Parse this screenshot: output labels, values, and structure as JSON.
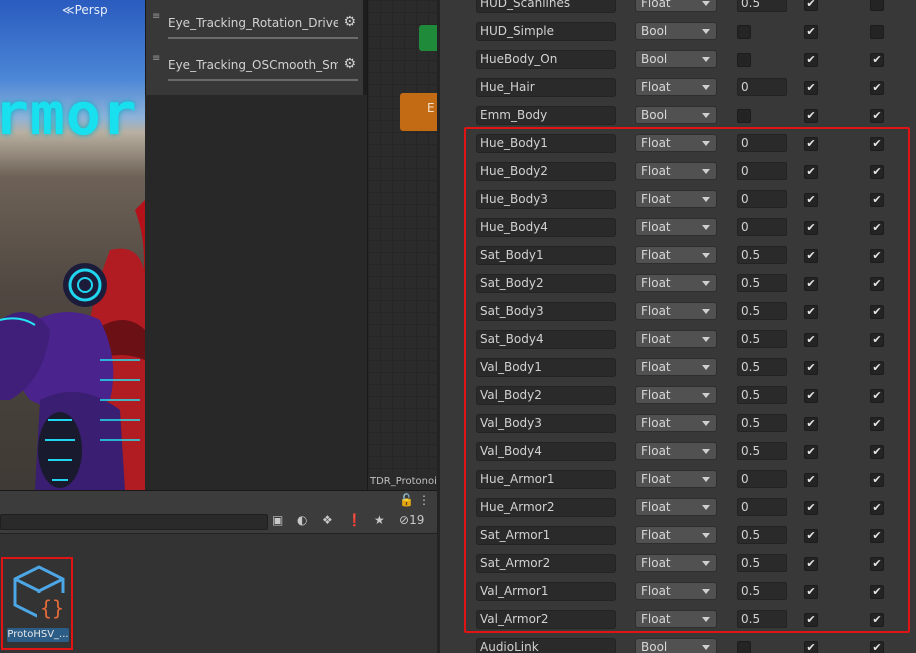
{
  "scene": {
    "view_label": "Persp",
    "neon_text": "rmor"
  },
  "layers": [
    {
      "name": "Eye_Tracking_Rotation_Driver"
    },
    {
      "name": "Eye_Tracking_OSCmooth_Smc"
    }
  ],
  "graph": {
    "footer": "TDR_Protonoid"
  },
  "project": {
    "hidden_count": "19",
    "asset_label": "ProtoHSV_..."
  },
  "params": [
    {
      "name": "HUD_Scanlines",
      "type": "Float",
      "default": "0.5",
      "c1": true,
      "c2": false
    },
    {
      "name": "HUD_Simple",
      "type": "Bool",
      "default": false,
      "c1": true,
      "c2": false
    },
    {
      "name": "HueBody_On",
      "type": "Bool",
      "default": false,
      "c1": true,
      "c2": true
    },
    {
      "name": "Hue_Hair",
      "type": "Float",
      "default": "0",
      "c1": true,
      "c2": true
    },
    {
      "name": "Emm_Body",
      "type": "Bool",
      "default": false,
      "c1": true,
      "c2": true
    },
    {
      "name": "Hue_Body1",
      "type": "Float",
      "default": "0",
      "c1": true,
      "c2": true
    },
    {
      "name": "Hue_Body2",
      "type": "Float",
      "default": "0",
      "c1": true,
      "c2": true
    },
    {
      "name": "Hue_Body3",
      "type": "Float",
      "default": "0",
      "c1": true,
      "c2": true
    },
    {
      "name": "Hue_Body4",
      "type": "Float",
      "default": "0",
      "c1": true,
      "c2": true
    },
    {
      "name": "Sat_Body1",
      "type": "Float",
      "default": "0.5",
      "c1": true,
      "c2": true
    },
    {
      "name": "Sat_Body2",
      "type": "Float",
      "default": "0.5",
      "c1": true,
      "c2": true
    },
    {
      "name": "Sat_Body3",
      "type": "Float",
      "default": "0.5",
      "c1": true,
      "c2": true
    },
    {
      "name": "Sat_Body4",
      "type": "Float",
      "default": "0.5",
      "c1": true,
      "c2": true
    },
    {
      "name": "Val_Body1",
      "type": "Float",
      "default": "0.5",
      "c1": true,
      "c2": true
    },
    {
      "name": "Val_Body2",
      "type": "Float",
      "default": "0.5",
      "c1": true,
      "c2": true
    },
    {
      "name": "Val_Body3",
      "type": "Float",
      "default": "0.5",
      "c1": true,
      "c2": true
    },
    {
      "name": "Val_Body4",
      "type": "Float",
      "default": "0.5",
      "c1": true,
      "c2": true
    },
    {
      "name": "Hue_Armor1",
      "type": "Float",
      "default": "0",
      "c1": true,
      "c2": true
    },
    {
      "name": "Hue_Armor2",
      "type": "Float",
      "default": "0",
      "c1": true,
      "c2": true
    },
    {
      "name": "Sat_Armor1",
      "type": "Float",
      "default": "0.5",
      "c1": true,
      "c2": true
    },
    {
      "name": "Sat_Armor2",
      "type": "Float",
      "default": "0.5",
      "c1": true,
      "c2": true
    },
    {
      "name": "Val_Armor1",
      "type": "Float",
      "default": "0.5",
      "c1": true,
      "c2": true
    },
    {
      "name": "Val_Armor2",
      "type": "Float",
      "default": "0.5",
      "c1": true,
      "c2": true
    },
    {
      "name": "AudioLink",
      "type": "Bool",
      "default": false,
      "c1": true,
      "c2": true
    }
  ],
  "colors": {
    "highlight": "#e01414",
    "node_green": "#208a3b",
    "node_orange": "#c26a14",
    "neon": "#19e0ef",
    "asset_label_bg": "#2c5d87"
  }
}
